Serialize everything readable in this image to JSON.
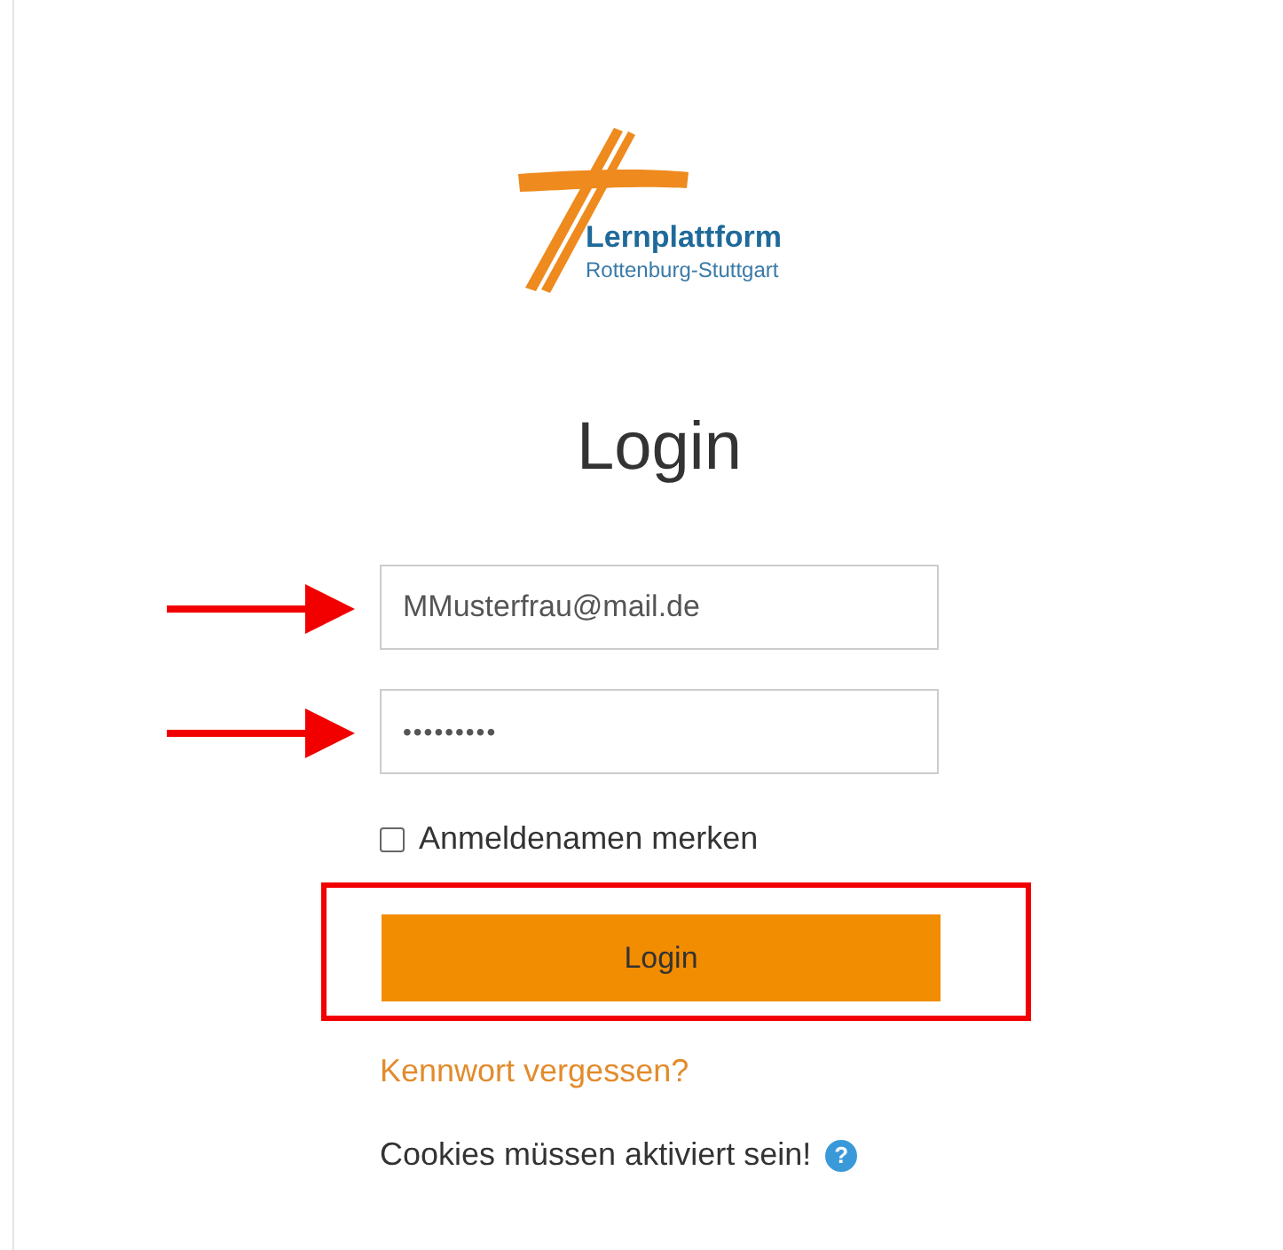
{
  "logo": {
    "title": "Lernplattform",
    "subtitle": "Rottenburg-Stuttgart"
  },
  "heading": "Login",
  "fields": [
    {
      "kind": "text",
      "value": "MMusterfrau@mail.de",
      "annotated": true
    },
    {
      "kind": "password",
      "value": "•••••••••",
      "annotated": true
    }
  ],
  "remember": {
    "label": "Anmeldenamen merken",
    "checked": false
  },
  "login_button": {
    "label": "Login",
    "highlighted": true
  },
  "forgot_link": "Kennwort vergessen?",
  "cookies_note": {
    "text": "Cookies müssen aktiviert sein!",
    "help_icon": "?"
  }
}
